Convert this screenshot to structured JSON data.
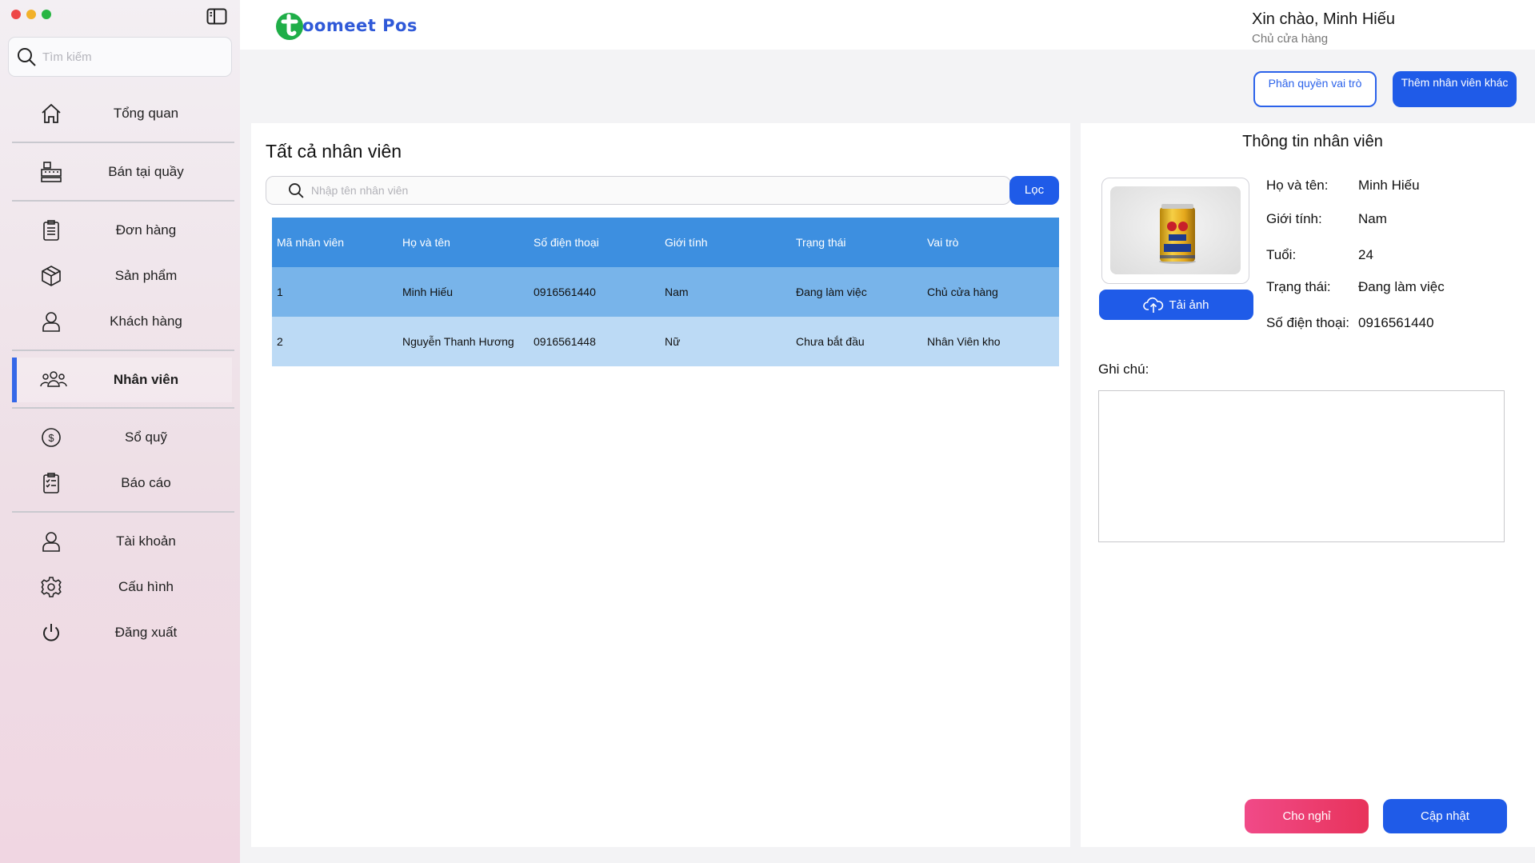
{
  "window": {
    "traffic_colors": [
      "#ee4747",
      "#f2b12a",
      "#28b543"
    ]
  },
  "sidebar": {
    "search_placeholder": "Tìm kiếm",
    "items": [
      {
        "label": "Tổng quan",
        "icon": "home-icon"
      },
      {
        "label": "Bán tại quầy",
        "icon": "cash-register-icon"
      },
      {
        "label": "Đơn hàng",
        "icon": "clipboard-icon"
      },
      {
        "label": "Sản phẩm",
        "icon": "box-icon"
      },
      {
        "label": "Khách hàng",
        "icon": "user-icon"
      },
      {
        "label": "Nhân viên",
        "icon": "users-group-icon",
        "active": true
      },
      {
        "label": "Sổ quỹ",
        "icon": "dollar-circle-icon"
      },
      {
        "label": "Báo cáo",
        "icon": "report-icon"
      },
      {
        "label": "Tài khoản",
        "icon": "account-icon"
      },
      {
        "label": "Cấu hình",
        "icon": "gear-icon"
      },
      {
        "label": "Đăng xuất",
        "icon": "power-icon"
      }
    ]
  },
  "header": {
    "logo_text": "oomeet Pos",
    "greeting": "Xin chào, Minh Hiếu",
    "role": "Chủ cửa hàng"
  },
  "actions": {
    "permissions_label": "Phân quyền vai trò",
    "add_employee_label": "Thêm nhân viên khác"
  },
  "employees": {
    "title": "Tất cả nhân viên",
    "search_placeholder": "Nhập tên nhân viên",
    "filter_label": "Lọc",
    "columns": [
      "Mã nhân viên",
      "Họ và tên",
      "Số điện thoại",
      "Giới tính",
      "Trạng thái",
      "Vai trò"
    ],
    "rows": [
      [
        "1",
        "Minh Hiếu",
        "0916561440",
        "Nam",
        "Đang làm việc",
        "Chủ cửa hàng"
      ],
      [
        "2",
        "Nguyễn Thanh Hương",
        "0916561448",
        "Nữ",
        "Chưa bắt đầu",
        "Nhân Viên kho"
      ]
    ]
  },
  "detail": {
    "title": "Thông tin nhân viên",
    "upload_label": "Tải ảnh",
    "fields": [
      {
        "key": "Họ và tên:",
        "value": "Minh Hiếu"
      },
      {
        "key": "Giới tính:",
        "value": "Nam"
      },
      {
        "key": "Tuổi:",
        "value": "24"
      },
      {
        "key": "Trạng thái:",
        "value": "Đang làm việc"
      },
      {
        "key": "Số điện thoại:",
        "value": "0916561440"
      }
    ],
    "note_label": "Ghi chú:",
    "note_value": "",
    "leave_label": "Cho nghỉ",
    "update_label": "Cập nhật"
  }
}
